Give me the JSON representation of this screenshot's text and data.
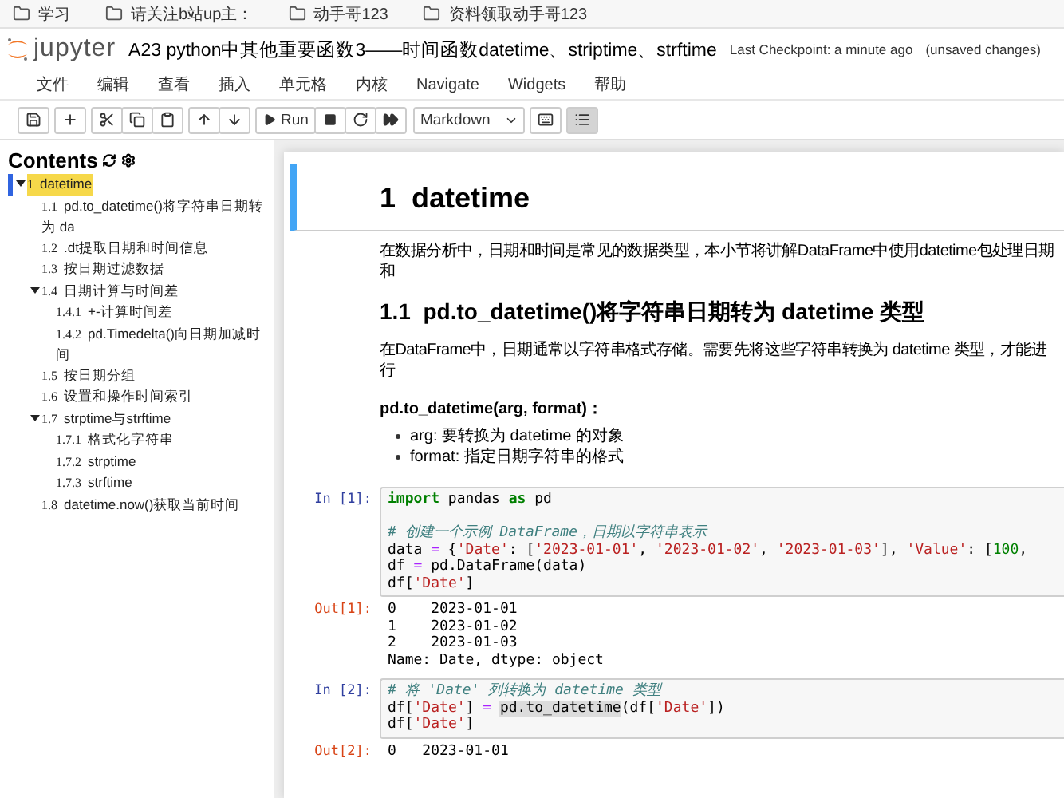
{
  "bookmarks": [
    {
      "label": "学习"
    },
    {
      "label": "请关注b站up主："
    },
    {
      "label": "动手哥123"
    },
    {
      "label": "资料领取动手哥123"
    }
  ],
  "header": {
    "logo_text": "jupyter",
    "title": "A23 python中其他重要函数3——时间函数datetime、striptime、strftime",
    "checkpoint": "Last Checkpoint: a minute ago",
    "status": "(unsaved changes)"
  },
  "menu": [
    "文件",
    "编辑",
    "查看",
    "插入",
    "单元格",
    "内核",
    "Navigate",
    "Widgets",
    "帮助"
  ],
  "toolbar": {
    "run_label": "Run",
    "cell_type": "Markdown",
    "toc_button_active": true
  },
  "toc": {
    "title": "Contents",
    "items": [
      {
        "number": "1",
        "title": "datetime",
        "selected": true,
        "expanded": true,
        "children": [
          {
            "number": "1.1",
            "title": "pd.to_datetime()将字符串日期转为 da",
            "selected": false
          },
          {
            "number": "1.2",
            "title": ".dt提取日期和时间信息",
            "selected": false
          },
          {
            "number": "1.3",
            "title": "按日期过滤数据",
            "selected": false
          },
          {
            "number": "1.4",
            "title": "日期计算与时间差",
            "selected": false,
            "expanded": true,
            "children": [
              {
                "number": "1.4.1",
                "title": "+-计算时间差",
                "selected": false
              },
              {
                "number": "1.4.2",
                "title": "pd.Timedelta()向日期加减时间",
                "selected": false
              }
            ]
          },
          {
            "number": "1.5",
            "title": "按日期分组",
            "selected": false
          },
          {
            "number": "1.6",
            "title": "设置和操作时间索引",
            "selected": false
          },
          {
            "number": "1.7",
            "title": "strptime与strftime",
            "selected": false,
            "expanded": true,
            "children": [
              {
                "number": "1.7.1",
                "title": "格式化字符串",
                "selected": false
              },
              {
                "number": "1.7.2",
                "title": "strptime",
                "selected": false
              },
              {
                "number": "1.7.3",
                "title": "strftime",
                "selected": false
              }
            ]
          },
          {
            "number": "1.8",
            "title": "datetime.now()获取当前时间",
            "selected": false
          }
        ]
      }
    ]
  },
  "cells": [
    {
      "kind": "markdown",
      "selected": true,
      "blocks": [
        {
          "kind": "h1",
          "number": "1",
          "text": "datetime"
        }
      ]
    },
    {
      "kind": "markdown",
      "selected": false,
      "blocks": [
        {
          "kind": "p",
          "text": "在数据分析中，日期和时间是常见的数据类型，本小节将讲解DataFrame中使用datetime包处理日期和"
        },
        {
          "kind": "h2",
          "number": "1.1",
          "text": "pd.to_datetime()将字符串日期转为 datetime 类型"
        },
        {
          "kind": "p",
          "text": "在DataFrame中，日期通常以字符串格式存储。需要先将这些字符串转换为 datetime 类型，才能进行"
        },
        {
          "kind": "strong",
          "text": "pd.to_datetime(arg, format)："
        },
        {
          "kind": "list",
          "items": [
            "arg: 要转换为 datetime 的对象",
            "format: 指定日期字符串的格式"
          ]
        }
      ]
    },
    {
      "kind": "code",
      "selected": false,
      "prompt": "In [1]:",
      "lines": [
        {
          "spans": [
            {
              "kind": "keyword",
              "text": "import"
            },
            {
              "kind": "plain",
              "text": " pandas "
            },
            {
              "kind": "keyword",
              "text": "as"
            },
            {
              "kind": "plain",
              "text": " pd"
            }
          ]
        },
        {
          "blank_before": true,
          "spans": [
            {
              "kind": "comment",
              "text": "# 创建一个示例 DataFrame，日期以字符串表示"
            }
          ]
        },
        {
          "spans": [
            {
              "kind": "plain",
              "text": "data "
            },
            {
              "kind": "operator",
              "text": "="
            },
            {
              "kind": "plain",
              "text": " {"
            },
            {
              "kind": "string",
              "text": "'Date'"
            },
            {
              "kind": "plain",
              "text": ": ["
            },
            {
              "kind": "string",
              "text": "'2023-01-01'"
            },
            {
              "kind": "plain",
              "text": ", "
            },
            {
              "kind": "string",
              "text": "'2023-01-02'"
            },
            {
              "kind": "plain",
              "text": ", "
            },
            {
              "kind": "string",
              "text": "'2023-01-03'"
            },
            {
              "kind": "plain",
              "text": "], "
            },
            {
              "kind": "string",
              "text": "'Value'"
            },
            {
              "kind": "plain",
              "text": ": ["
            },
            {
              "kind": "number",
              "text": "100"
            },
            {
              "kind": "plain",
              "text": ","
            }
          ]
        },
        {
          "spans": [
            {
              "kind": "plain",
              "text": "df "
            },
            {
              "kind": "operator",
              "text": "="
            },
            {
              "kind": "plain",
              "text": " pd.DataFrame(data)"
            }
          ]
        },
        {
          "spans": [
            {
              "kind": "plain",
              "text": "df["
            },
            {
              "kind": "string",
              "text": "'Date'"
            },
            {
              "kind": "plain",
              "text": "]"
            }
          ]
        }
      ],
      "output": {
        "prompt": "Out[1]:",
        "lines": [
          "0    2023-01-01",
          "1    2023-01-02",
          "2    2023-01-03",
          "Name: Date, dtype: object"
        ]
      }
    },
    {
      "kind": "code",
      "selected": false,
      "prompt": "In [2]:",
      "lines": [
        {
          "spans": [
            {
              "kind": "comment",
              "text": "# 将 'Date' 列转换为 datetime 类型"
            }
          ]
        },
        {
          "spans": [
            {
              "kind": "plain",
              "text": "df["
            },
            {
              "kind": "string",
              "text": "'Date'"
            },
            {
              "kind": "plain",
              "text": "]"
            },
            {
              "kind": "operator",
              "text": " = "
            },
            {
              "kind": "match",
              "text": "pd.to_datetime"
            },
            {
              "kind": "plain",
              "text": "(df["
            },
            {
              "kind": "string",
              "text": "'Date'"
            },
            {
              "kind": "plain",
              "text": "])"
            }
          ]
        },
        {
          "spans": [
            {
              "kind": "plain",
              "text": "df["
            },
            {
              "kind": "string",
              "text": "'Date'"
            },
            {
              "kind": "plain",
              "text": "]"
            }
          ]
        }
      ],
      "output": {
        "prompt": "Out[2]:",
        "lines": [
          "0   2023-01-01"
        ]
      }
    }
  ]
}
